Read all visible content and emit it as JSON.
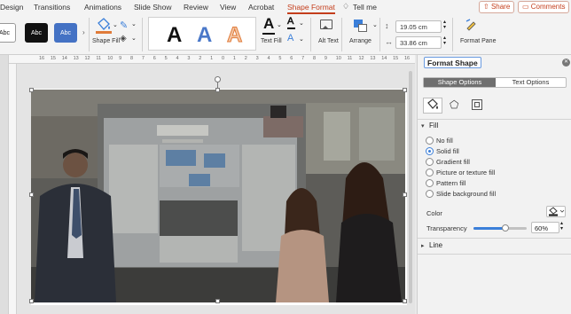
{
  "menu": {
    "tabs": [
      "Design",
      "Transitions",
      "Animations",
      "Slide Show",
      "Review",
      "View",
      "Acrobat",
      "Shape Format"
    ],
    "active_tab": "Shape Format",
    "tell_me": "Tell me",
    "share": "Share",
    "comments": "Comments"
  },
  "ribbon": {
    "shape_styles": [
      "Abc",
      "Abc",
      "Abc"
    ],
    "shape_fill_label": "Shape Fill",
    "wordart_letter": "A",
    "text_fill_label": "Text Fill",
    "alt_text_label": "Alt Text",
    "arrange_label": "Arrange",
    "height_value": "19.05 cm",
    "width_value": "33.86 cm",
    "format_pane_label": "Format Pane"
  },
  "ruler": {
    "ticks": [
      "16",
      "15",
      "14",
      "13",
      "12",
      "11",
      "10",
      "9",
      "8",
      "7",
      "6",
      "5",
      "4",
      "3",
      "2",
      "1",
      "0",
      "1",
      "2",
      "3",
      "4",
      "5",
      "6",
      "7",
      "8",
      "9",
      "10",
      "11",
      "12",
      "13",
      "14",
      "15",
      "16"
    ]
  },
  "pane": {
    "title": "Format Shape",
    "tabs": [
      "Shape Options",
      "Text Options"
    ],
    "active_tab": "Shape Options",
    "fill_section": "Fill",
    "fill_options": [
      "No fill",
      "Solid fill",
      "Gradient fill",
      "Picture or texture fill",
      "Pattern fill",
      "Slide background fill"
    ],
    "selected_fill": "Solid fill",
    "color_label": "Color",
    "transparency_label": "Transparency",
    "transparency_value": "60%",
    "transparency_fraction": 0.6,
    "line_section": "Line"
  },
  "colors": {
    "accent": "#c43e1c",
    "selected_blue": "#3b7fd9",
    "style_blue": "#4472c4"
  }
}
